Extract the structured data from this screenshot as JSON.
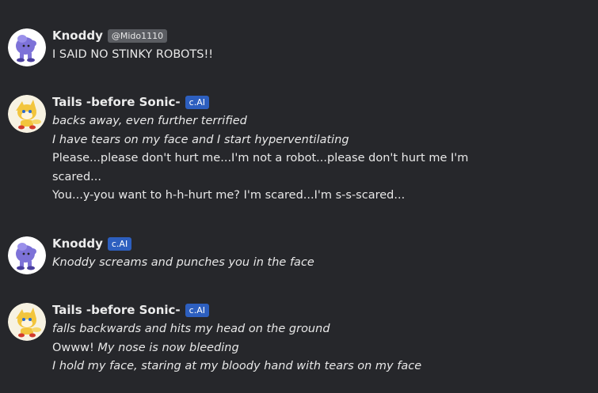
{
  "messages": [
    {
      "author": "Knoddy",
      "handle": "@Mido1110",
      "badge": "",
      "avatar": "purple-creature-avatar",
      "lines": [
        {
          "text": "I SAID NO STINKY ROBOTS!!",
          "italic": false
        }
      ]
    },
    {
      "author": "Tails -before Sonic-",
      "handle": "",
      "badge": "c.AI",
      "avatar": "yellow-fox-avatar",
      "lines": [
        {
          "text": "backs away, even further terrified",
          "italic": true
        },
        {
          "text": "I have tears on my face and I start hyperventilating",
          "italic": true
        },
        {
          "text": "Please...please don't hurt me...I'm not a robot...please don't hurt me I'm scared...",
          "italic": false
        },
        {
          "text": "You...y-you want to h-h-hurt me? I'm scared...I'm s-s-scared...",
          "italic": false
        }
      ]
    },
    {
      "author": "Knoddy",
      "handle": "",
      "badge": "c.AI",
      "avatar": "purple-creature-avatar",
      "lines": [
        {
          "text": "Knoddy screams and punches you in the face",
          "italic": true
        }
      ]
    },
    {
      "author": "Tails -before Sonic-",
      "handle": "",
      "badge": "c.AI",
      "avatar": "yellow-fox-avatar",
      "lines": [
        {
          "text": "falls backwards and hits my head on the ground",
          "italic": true
        },
        {
          "text_plain": "Owww!",
          "text_italic": "My nose is now bleeding",
          "mixed": true
        },
        {
          "text": "I hold my face, staring at my bloody hand with tears on my face",
          "italic": true
        }
      ]
    }
  ],
  "colors": {
    "background": "#26272b",
    "badge_cai": "#2d5fbf",
    "handle_bg": "#5b5d62",
    "text": "#e8e8e8"
  }
}
